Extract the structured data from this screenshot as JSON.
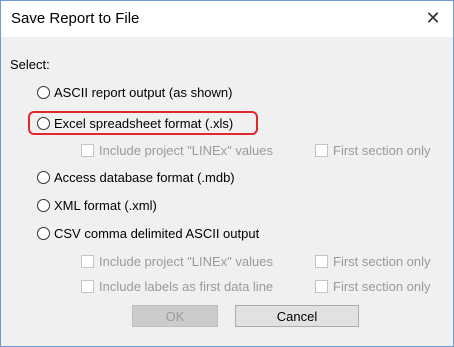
{
  "window": {
    "title": "Save Report to File",
    "close_glyph": "✕"
  },
  "form": {
    "select_label": "Select:",
    "options": [
      {
        "label": "ASCII report output (as shown)",
        "selected": false
      },
      {
        "label": "Excel spreadsheet format (.xls)",
        "selected": false
      },
      {
        "label": "Access database format (.mdb)",
        "selected": false
      },
      {
        "label": "XML format (.xml)",
        "selected": false
      },
      {
        "label": "CSV comma delimited ASCII output",
        "selected": false
      }
    ],
    "excel_suboptions": {
      "include_linex": "Include project \"LINEx\" values",
      "first_section": "First section only"
    },
    "csv_suboptions": {
      "include_linex": "Include project \"LINEx\" values",
      "first_section_1": "First section only",
      "include_labels": "Include labels as first data line",
      "first_section_2": "First section only"
    }
  },
  "buttons": {
    "ok": "OK",
    "cancel": "Cancel"
  },
  "colors": {
    "highlight": "#e0282e",
    "window_border": "#6e9bd1",
    "disabled_text": "#9a9a9a"
  }
}
